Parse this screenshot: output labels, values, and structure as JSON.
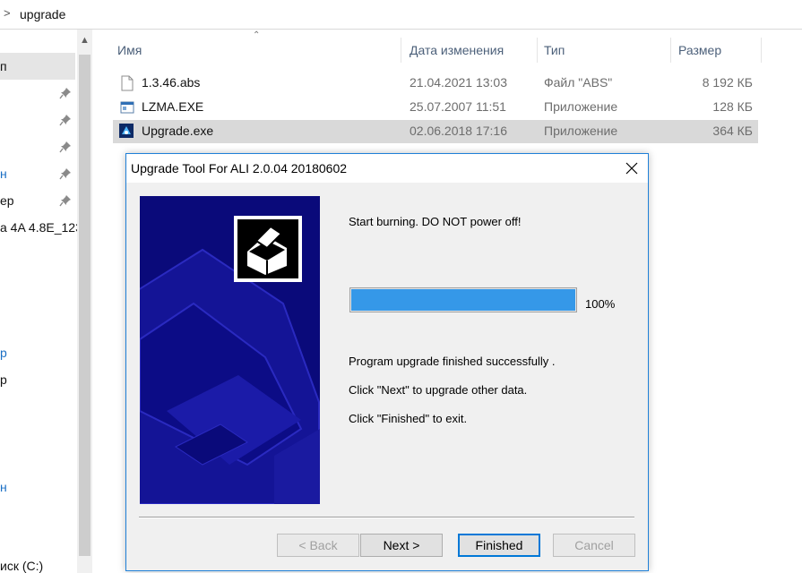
{
  "explorer": {
    "address": {
      "path": "upgrade"
    },
    "nav": {
      "items": [
        {
          "label": "п"
        },
        {
          "label": ""
        },
        {
          "label": ""
        },
        {
          "label": ""
        },
        {
          "label": "н"
        },
        {
          "label": "ер"
        },
        {
          "label": "а 4A 4.8E_123"
        },
        {
          "label": "р"
        },
        {
          "label": "р"
        },
        {
          "label": "н"
        },
        {
          "label": "иск (C:)"
        }
      ]
    },
    "columns": {
      "name": "Имя",
      "date": "Дата изменения",
      "type": "Тип",
      "size": "Размер"
    },
    "files": [
      {
        "name": "1.3.46.abs",
        "date": "21.04.2021 13:03",
        "type": "Файл \"ABS\"",
        "size": "8 192 КБ",
        "icon": "file-icon"
      },
      {
        "name": "LZMA.EXE",
        "date": "25.07.2007 11:51",
        "type": "Приложение",
        "size": "128 КБ",
        "icon": "app-window-icon"
      },
      {
        "name": "Upgrade.exe",
        "date": "02.06.2018 17:16",
        "type": "Приложение",
        "size": "364 КБ",
        "icon": "upgrade-app-icon"
      }
    ]
  },
  "dialog": {
    "title": "Upgrade Tool For ALI 2.0.04 20180602",
    "status": "Start burning. DO NOT power off!",
    "progress": {
      "value": 100,
      "label": "100%"
    },
    "messages": [
      "Program upgrade finished successfully .",
      "Click \"Next\" to upgrade other data.",
      "Click \"Finished\" to exit."
    ],
    "buttons": {
      "back": "< Back",
      "next": "Next >",
      "finished": "Finished",
      "cancel": "Cancel"
    }
  },
  "colors": {
    "banner": "#0a0a7a",
    "progress_fill": "#3598e8",
    "dialog_border": "#1f80d8",
    "selection": "#d9d9d9"
  }
}
